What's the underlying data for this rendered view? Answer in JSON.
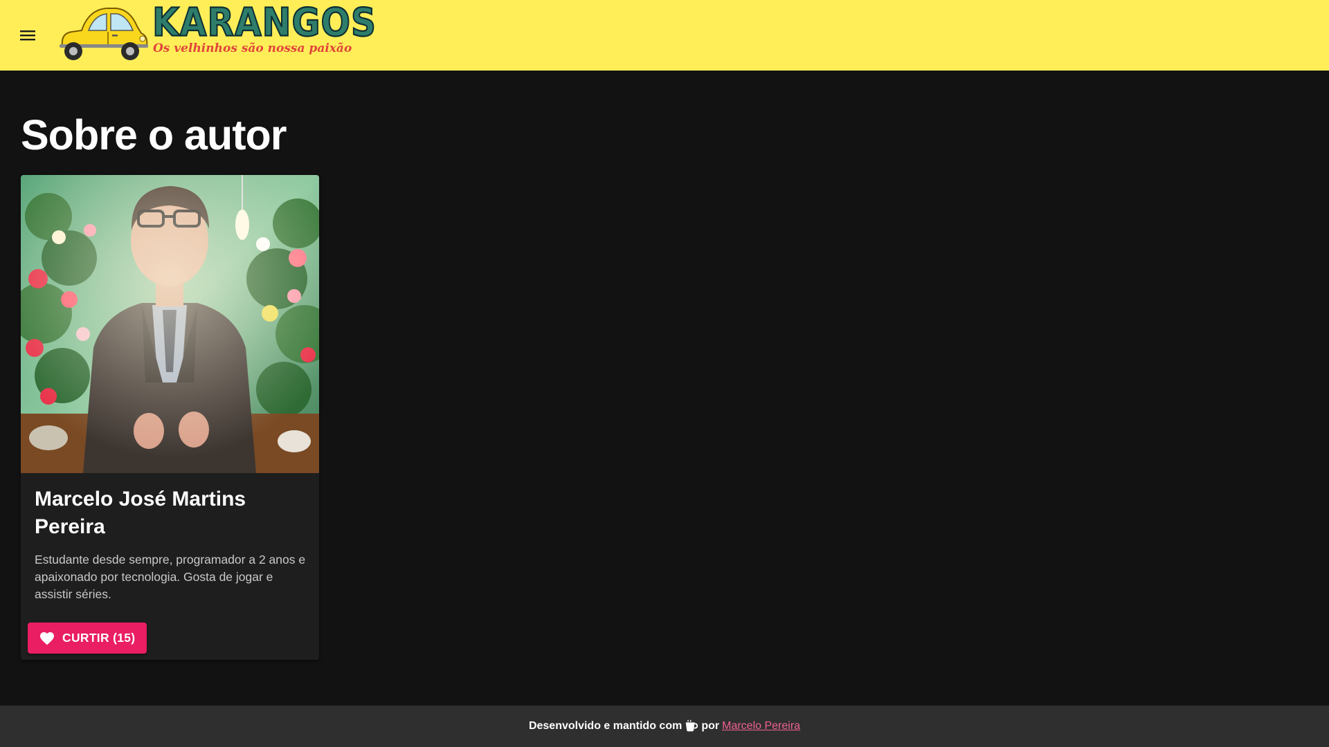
{
  "header": {
    "menu_icon": "hamburger-menu-icon",
    "logo_title": "KARANGOS",
    "logo_tagline": "Os velhinhos são nossa paixão",
    "background_color": "#ffee58"
  },
  "main": {
    "page_title": "Sobre o autor",
    "card": {
      "name": "Marcelo José Martins Pereira",
      "description": "Estudante desde sempre, programador a 2 anos e apaixonado por tecnologia. Gosta de jogar e assistir séries.",
      "like_button_label": "CURTIR (15)",
      "like_icon": "heart-icon",
      "like_count": 15,
      "button_color": "#e91e63"
    }
  },
  "footer": {
    "text_before": "Desenvolvido e mantido com",
    "icon": "coffee-cup-icon",
    "text_middle": "por",
    "author_link": "Marcelo Pereira",
    "link_color": "#f06292"
  }
}
